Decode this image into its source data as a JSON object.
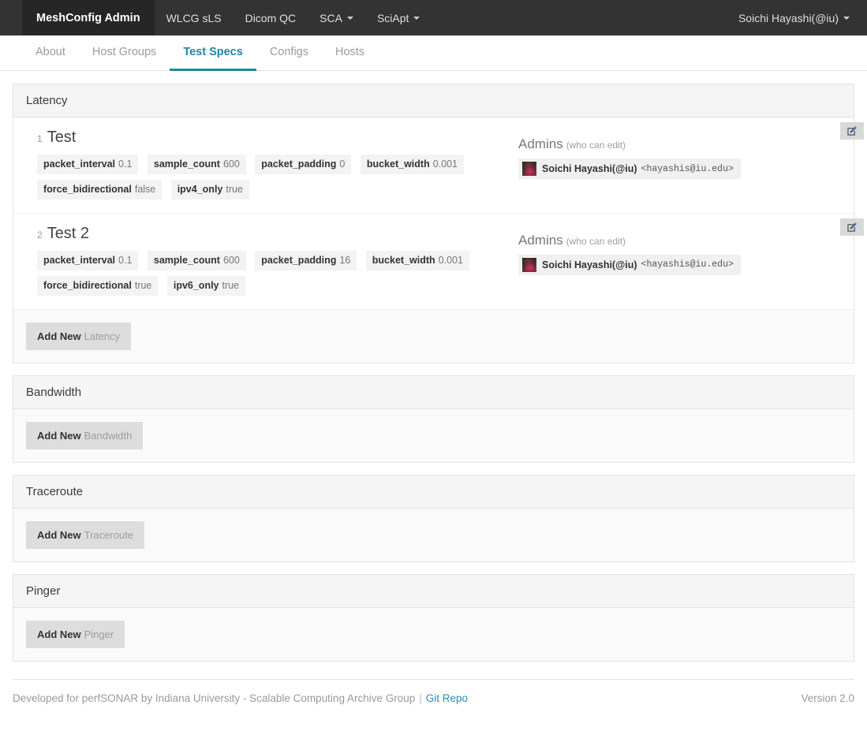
{
  "navbar": {
    "brand": "MeshConfig Admin",
    "items": [
      {
        "label": "WLCG sLS",
        "caret": false
      },
      {
        "label": "Dicom QC",
        "caret": false
      },
      {
        "label": "SCA",
        "caret": true
      },
      {
        "label": "SciApt",
        "caret": true
      }
    ],
    "user": "Soichi Hayashi(@iu)",
    "user_caret_icon": "caret-down-icon",
    "bg_color": "#333333",
    "brand_bg_color": "#262626"
  },
  "subnav": {
    "tabs": [
      {
        "label": "About",
        "active": false
      },
      {
        "label": "Host Groups",
        "active": false
      },
      {
        "label": "Test Specs",
        "active": true
      },
      {
        "label": "Configs",
        "active": false
      },
      {
        "label": "Hosts",
        "active": false
      }
    ],
    "active_color": "#1b87a8"
  },
  "panels": [
    {
      "title": "Latency",
      "add_label_strong": "Add New",
      "add_label_muted": "Latency",
      "specs": [
        {
          "number": "1",
          "name": "Test",
          "edit_icon": "edit-pencil-icon",
          "tags": [
            {
              "key": "packet_interval",
              "value": "0.1"
            },
            {
              "key": "sample_count",
              "value": "600"
            },
            {
              "key": "packet_padding",
              "value": "0"
            },
            {
              "key": "bucket_width",
              "value": "0.001"
            },
            {
              "key": "force_bidirectional",
              "value": "false"
            },
            {
              "key": "ipv4_only",
              "value": "true"
            }
          ],
          "admins_title": "Admins",
          "admins_hint": "(who can edit)",
          "admins": [
            {
              "name": "Soichi Hayashi(@iu)",
              "email": "<hayashis@iu.edu>",
              "avatar_icon": "user-avatar-image"
            }
          ]
        },
        {
          "number": "2",
          "name": "Test 2",
          "edit_icon": "edit-pencil-icon",
          "tags": [
            {
              "key": "packet_interval",
              "value": "0.1"
            },
            {
              "key": "sample_count",
              "value": "600"
            },
            {
              "key": "packet_padding",
              "value": "16"
            },
            {
              "key": "bucket_width",
              "value": "0.001"
            },
            {
              "key": "force_bidirectional",
              "value": "true"
            },
            {
              "key": "ipv6_only",
              "value": "true"
            }
          ],
          "admins_title": "Admins",
          "admins_hint": "(who can edit)",
          "admins": [
            {
              "name": "Soichi Hayashi(@iu)",
              "email": "<hayashis@iu.edu>",
              "avatar_icon": "user-avatar-image"
            }
          ]
        }
      ]
    },
    {
      "title": "Bandwidth",
      "add_label_strong": "Add New",
      "add_label_muted": "Bandwidth",
      "specs": []
    },
    {
      "title": "Traceroute",
      "add_label_strong": "Add New",
      "add_label_muted": "Traceroute",
      "specs": []
    },
    {
      "title": "Pinger",
      "add_label_strong": "Add New",
      "add_label_muted": "Pinger",
      "specs": []
    }
  ],
  "footer": {
    "credit": "Developed for perfSONAR by Indiana University - Scalable Computing Archive Group",
    "separator": "|",
    "link_label": "Git Repo",
    "version": "Version 2.0"
  }
}
